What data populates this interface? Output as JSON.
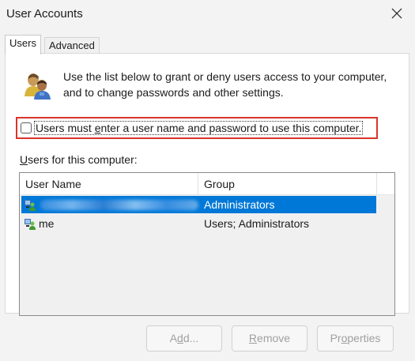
{
  "window": {
    "title": "User Accounts"
  },
  "tabs": [
    {
      "label": "Users",
      "active": true
    },
    {
      "label": "Advanced",
      "active": false
    }
  ],
  "users_tab": {
    "description": "Use the list below to grant or deny users access to your computer, and to change passwords and other settings.",
    "require_login_checkbox": {
      "label_before": "Users must ",
      "label_accel": "e",
      "label_after": "nter a user name and password to use this computer.",
      "checked": false
    },
    "users_label_accel": "U",
    "users_label_rest": "sers for this computer:",
    "list": {
      "columns": [
        "User Name",
        "Group"
      ],
      "rows": [
        {
          "user_name": "",
          "group": "Administrators",
          "selected": true,
          "obscured": true
        },
        {
          "user_name": "me",
          "group": "Users; Administrators",
          "selected": false,
          "obscured": false
        }
      ]
    },
    "buttons": {
      "add": {
        "before": "A",
        "accel": "d",
        "after": "d..."
      },
      "remove": {
        "before": "",
        "accel": "R",
        "after": "emove"
      },
      "properties": {
        "before": "Pr",
        "accel": "o",
        "after": "perties"
      }
    }
  },
  "colors": {
    "selection": "#0078d7",
    "highlight_border": "#d9342b",
    "disabled_text": "#a0a0a0"
  }
}
